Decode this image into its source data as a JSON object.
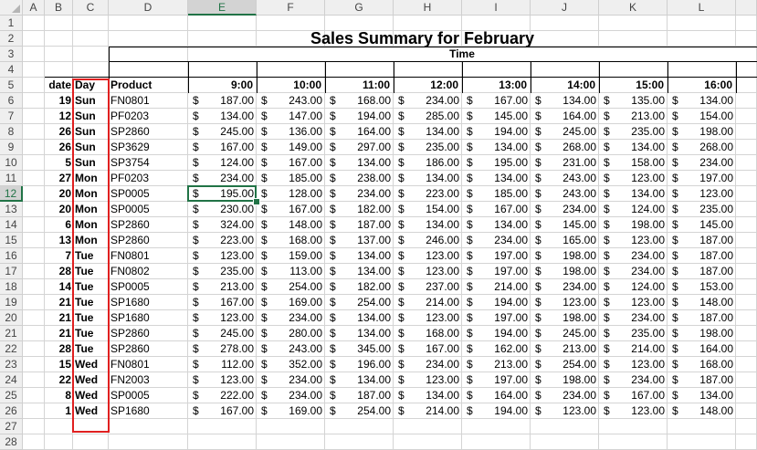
{
  "sheet": {
    "columns": [
      "A",
      "B",
      "C",
      "D",
      "E",
      "F",
      "G",
      "H",
      "I",
      "J",
      "K",
      "L"
    ],
    "selected_column": "E",
    "selected_row": 12,
    "title": "Sales Summary for February",
    "time_label": "Time",
    "headers": {
      "date": "date",
      "day": "Day",
      "product": "Product"
    },
    "times": [
      "9:00",
      "10:00",
      "11:00",
      "12:00",
      "13:00",
      "14:00",
      "15:00",
      "16:00"
    ],
    "currency": "$",
    "rows": [
      {
        "n": 6,
        "date": "19",
        "day": "Sun",
        "product": "FN0801",
        "values": [
          "187.00",
          "243.00",
          "168.00",
          "234.00",
          "167.00",
          "134.00",
          "135.00",
          "134.00"
        ]
      },
      {
        "n": 7,
        "date": "12",
        "day": "Sun",
        "product": "PF0203",
        "values": [
          "134.00",
          "147.00",
          "194.00",
          "285.00",
          "145.00",
          "164.00",
          "213.00",
          "154.00"
        ]
      },
      {
        "n": 8,
        "date": "26",
        "day": "Sun",
        "product": "SP2860",
        "values": [
          "245.00",
          "136.00",
          "164.00",
          "134.00",
          "194.00",
          "245.00",
          "235.00",
          "198.00"
        ]
      },
      {
        "n": 9,
        "date": "26",
        "day": "Sun",
        "product": "SP3629",
        "values": [
          "167.00",
          "149.00",
          "297.00",
          "235.00",
          "134.00",
          "268.00",
          "134.00",
          "268.00"
        ]
      },
      {
        "n": 10,
        "date": "5",
        "day": "Sun",
        "product": "SP3754",
        "values": [
          "124.00",
          "167.00",
          "134.00",
          "186.00",
          "195.00",
          "231.00",
          "158.00",
          "234.00"
        ]
      },
      {
        "n": 11,
        "date": "27",
        "day": "Mon",
        "product": "PF0203",
        "values": [
          "234.00",
          "185.00",
          "238.00",
          "134.00",
          "134.00",
          "243.00",
          "123.00",
          "197.00"
        ]
      },
      {
        "n": 12,
        "date": "20",
        "day": "Mon",
        "product": "SP0005",
        "values": [
          "195.00",
          "128.00",
          "234.00",
          "223.00",
          "185.00",
          "243.00",
          "134.00",
          "123.00"
        ]
      },
      {
        "n": 13,
        "date": "20",
        "day": "Mon",
        "product": "SP0005",
        "values": [
          "230.00",
          "167.00",
          "182.00",
          "154.00",
          "167.00",
          "234.00",
          "124.00",
          "235.00"
        ]
      },
      {
        "n": 14,
        "date": "6",
        "day": "Mon",
        "product": "SP2860",
        "values": [
          "324.00",
          "148.00",
          "187.00",
          "134.00",
          "134.00",
          "145.00",
          "198.00",
          "145.00"
        ]
      },
      {
        "n": 15,
        "date": "13",
        "day": "Mon",
        "product": "SP2860",
        "values": [
          "223.00",
          "168.00",
          "137.00",
          "246.00",
          "234.00",
          "165.00",
          "123.00",
          "187.00"
        ]
      },
      {
        "n": 16,
        "date": "7",
        "day": "Tue",
        "product": "FN0801",
        "values": [
          "123.00",
          "159.00",
          "134.00",
          "123.00",
          "197.00",
          "198.00",
          "234.00",
          "187.00"
        ]
      },
      {
        "n": 17,
        "date": "28",
        "day": "Tue",
        "product": "FN0802",
        "values": [
          "235.00",
          "113.00",
          "134.00",
          "123.00",
          "197.00",
          "198.00",
          "234.00",
          "187.00"
        ]
      },
      {
        "n": 18,
        "date": "14",
        "day": "Tue",
        "product": "SP0005",
        "values": [
          "213.00",
          "254.00",
          "182.00",
          "237.00",
          "214.00",
          "234.00",
          "124.00",
          "153.00"
        ]
      },
      {
        "n": 19,
        "date": "21",
        "day": "Tue",
        "product": "SP1680",
        "values": [
          "167.00",
          "169.00",
          "254.00",
          "214.00",
          "194.00",
          "123.00",
          "123.00",
          "148.00"
        ]
      },
      {
        "n": 20,
        "date": "21",
        "day": "Tue",
        "product": "SP1680",
        "values": [
          "123.00",
          "234.00",
          "134.00",
          "123.00",
          "197.00",
          "198.00",
          "234.00",
          "187.00"
        ]
      },
      {
        "n": 21,
        "date": "21",
        "day": "Tue",
        "product": "SP2860",
        "values": [
          "245.00",
          "280.00",
          "134.00",
          "168.00",
          "194.00",
          "245.00",
          "235.00",
          "198.00"
        ]
      },
      {
        "n": 22,
        "date": "28",
        "day": "Tue",
        "product": "SP2860",
        "values": [
          "278.00",
          "243.00",
          "345.00",
          "167.00",
          "162.00",
          "213.00",
          "214.00",
          "164.00"
        ]
      },
      {
        "n": 23,
        "date": "15",
        "day": "Wed",
        "product": "FN0801",
        "values": [
          "112.00",
          "352.00",
          "196.00",
          "234.00",
          "213.00",
          "254.00",
          "123.00",
          "168.00"
        ]
      },
      {
        "n": 24,
        "date": "22",
        "day": "Wed",
        "product": "FN2003",
        "values": [
          "123.00",
          "234.00",
          "134.00",
          "123.00",
          "197.00",
          "198.00",
          "234.00",
          "187.00"
        ]
      },
      {
        "n": 25,
        "date": "8",
        "day": "Wed",
        "product": "SP0005",
        "values": [
          "222.00",
          "234.00",
          "187.00",
          "134.00",
          "164.00",
          "234.00",
          "167.00",
          "134.00"
        ]
      },
      {
        "n": 26,
        "date": "1",
        "day": "Wed",
        "product": "SP1680",
        "values": [
          "167.00",
          "169.00",
          "254.00",
          "214.00",
          "194.00",
          "123.00",
          "123.00",
          "148.00"
        ]
      }
    ]
  },
  "colors": {
    "accent": "#217346",
    "highlight": "#e02020"
  }
}
